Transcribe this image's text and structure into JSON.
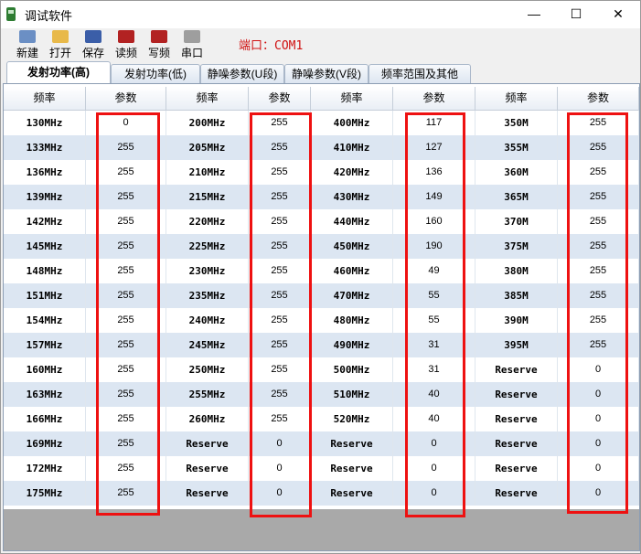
{
  "window": {
    "title": "调试软件",
    "minimize": "—",
    "maximize": "☐",
    "close": "✕"
  },
  "toolbar": {
    "buttons": [
      {
        "label": "新建",
        "icon": "new-file-icon",
        "color": "#6b8fc4"
      },
      {
        "label": "打开",
        "icon": "open-folder-icon",
        "color": "#e8b94a"
      },
      {
        "label": "保存",
        "icon": "save-icon",
        "color": "#3b5ea8"
      },
      {
        "label": "读频",
        "icon": "read-frequency-icon",
        "color": "#b22222"
      },
      {
        "label": "写频",
        "icon": "write-frequency-icon",
        "color": "#b22222"
      },
      {
        "label": "串口",
        "icon": "serial-port-icon",
        "color": "#9e9e9e"
      }
    ],
    "port_label": "端口：COM1"
  },
  "tabs": [
    {
      "label": "发射功率(高)",
      "active": true
    },
    {
      "label": "发射功率(低)",
      "active": false
    },
    {
      "label": "静噪参数(U段)",
      "active": false
    },
    {
      "label": "静噪参数(V段)",
      "active": false
    },
    {
      "label": "频率范围及其他",
      "active": false
    }
  ],
  "table": {
    "headers": [
      "频率",
      "参数",
      "频率",
      "参数",
      "频率",
      "参数",
      "频率",
      "参数"
    ],
    "rows": [
      [
        "130MHz",
        "0",
        "200MHz",
        "255",
        "400MHz",
        "117",
        "350M",
        "255"
      ],
      [
        "133MHz",
        "255",
        "205MHz",
        "255",
        "410MHz",
        "127",
        "355M",
        "255"
      ],
      [
        "136MHz",
        "255",
        "210MHz",
        "255",
        "420MHz",
        "136",
        "360M",
        "255"
      ],
      [
        "139MHz",
        "255",
        "215MHz",
        "255",
        "430MHz",
        "149",
        "365M",
        "255"
      ],
      [
        "142MHz",
        "255",
        "220MHz",
        "255",
        "440MHz",
        "160",
        "370M",
        "255"
      ],
      [
        "145MHz",
        "255",
        "225MHz",
        "255",
        "450MHz",
        "190",
        "375M",
        "255"
      ],
      [
        "148MHz",
        "255",
        "230MHz",
        "255",
        "460MHz",
        "49",
        "380M",
        "255"
      ],
      [
        "151MHz",
        "255",
        "235MHz",
        "255",
        "470MHz",
        "55",
        "385M",
        "255"
      ],
      [
        "154MHz",
        "255",
        "240MHz",
        "255",
        "480MHz",
        "55",
        "390M",
        "255"
      ],
      [
        "157MHz",
        "255",
        "245MHz",
        "255",
        "490MHz",
        "31",
        "395M",
        "255"
      ],
      [
        "160MHz",
        "255",
        "250MHz",
        "255",
        "500MHz",
        "31",
        "Reserve",
        "0"
      ],
      [
        "163MHz",
        "255",
        "255MHz",
        "255",
        "510MHz",
        "40",
        "Reserve",
        "0"
      ],
      [
        "166MHz",
        "255",
        "260MHz",
        "255",
        "520MHz",
        "40",
        "Reserve",
        "0"
      ],
      [
        "169MHz",
        "255",
        "Reserve",
        "0",
        "Reserve",
        "0",
        "Reserve",
        "0"
      ],
      [
        "172MHz",
        "255",
        "Reserve",
        "0",
        "Reserve",
        "0",
        "Reserve",
        "0"
      ],
      [
        "175MHz",
        "255",
        "Reserve",
        "0",
        "Reserve",
        "0",
        "Reserve",
        "0"
      ]
    ]
  },
  "colors": {
    "highlight": "#ee1111",
    "row_alt": "#dce6f2",
    "port_text": "#d01010"
  }
}
